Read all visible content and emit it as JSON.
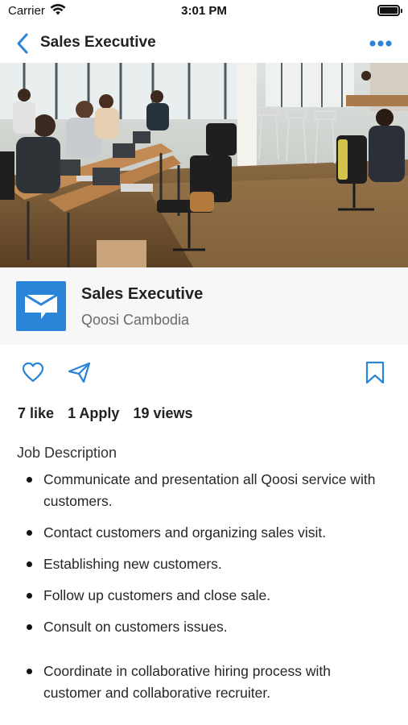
{
  "status_bar": {
    "carrier": "Carrier",
    "time": "3:01 PM"
  },
  "nav": {
    "title": "Sales Executive",
    "back_icon": "chevron-left-icon",
    "more_icon": "ellipsis-icon"
  },
  "company": {
    "job_title": "Sales Executive",
    "name": "Qoosi Cambodia",
    "logo_color": "#2a85d8"
  },
  "actions": {
    "like_icon": "heart-icon",
    "share_icon": "paper-plane-icon",
    "bookmark_icon": "bookmark-icon"
  },
  "stats": {
    "likes": "7 like",
    "applies": "1 Apply",
    "views": "19 views"
  },
  "description": {
    "heading": "Job Description",
    "items": [
      "Communicate and presentation all Qoosi service with customers.",
      "Contact customers and organizing sales visit.",
      "Establishing new customers.",
      "Follow up customers and close sale.",
      "Consult on customers issues.",
      "Coordinate in collaborative hiring process with customer and collaborative recruiter."
    ]
  },
  "colors": {
    "accent": "#2a85d8",
    "text": "#222222",
    "secondary": "#6a6a6a",
    "card_bg": "#f7f7f7"
  }
}
